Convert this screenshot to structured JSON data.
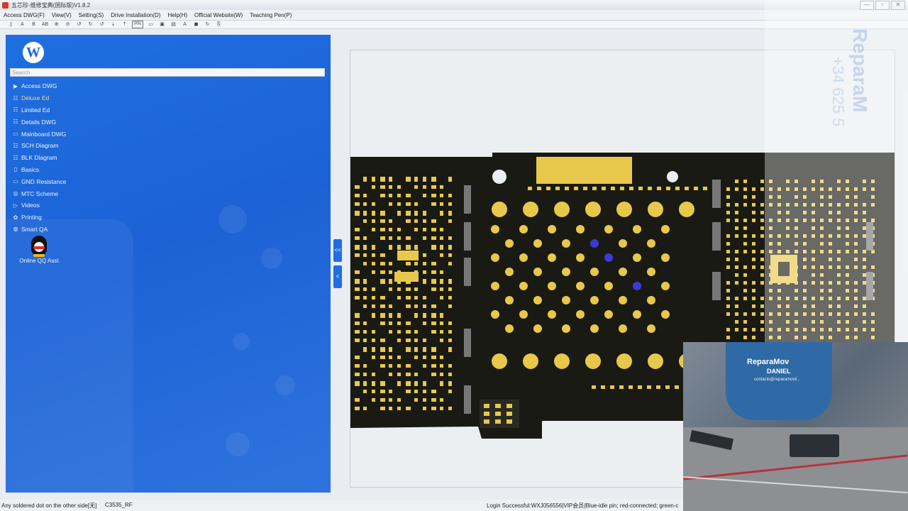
{
  "window": {
    "title": "五芯珍-维修宝典(国际版)V1.8.2",
    "controls": {
      "minimize": "—",
      "maximize": "▫",
      "close": "✕"
    }
  },
  "menu": [
    "Access DWG(F)",
    "View(V)",
    "Setting(S)",
    "Drive Installation(D)",
    "Help(H)",
    "Official Website(W)",
    "Teaching Pen(P)"
  ],
  "toolbar": {
    "tools": [
      "▯",
      "A",
      "B",
      "AB",
      "⊕",
      "⊖",
      "↺",
      "↻",
      "↺",
      "⇣",
      "⇡",
      "PIN",
      "▭",
      "▣",
      "▤",
      "A",
      "◼",
      "↻",
      "⎘"
    ]
  },
  "sidebar": {
    "logo": "W",
    "search_placeholder": "Search",
    "items": [
      {
        "icon": "▶",
        "label": "Access DWG",
        "active": false
      },
      {
        "icon": "☷",
        "label": "Deluxe Ed",
        "active": true
      },
      {
        "icon": "☷",
        "label": "Limited Ed",
        "active": false
      },
      {
        "icon": "☷",
        "label": "Details DWG",
        "active": false
      },
      {
        "icon": "▭",
        "label": "Mainboard DWG",
        "active": false
      },
      {
        "icon": "☷",
        "label": "SCH Diagram",
        "active": false
      },
      {
        "icon": "☷",
        "label": "BLK Diagram",
        "active": false
      },
      {
        "icon": "▯",
        "label": "Basics",
        "active": false
      },
      {
        "icon": "▭",
        "label": "GND Resistance",
        "active": false
      },
      {
        "icon": "◎",
        "label": "MTC Scheme",
        "active": false
      },
      {
        "icon": "▷",
        "label": "Videos",
        "active": false
      },
      {
        "icon": "✿",
        "label": "Printing",
        "active": false
      },
      {
        "icon": "◍",
        "label": "Smart QA",
        "active": false
      }
    ],
    "qq_label": "Online QQ Asst"
  },
  "collapse": {
    "top": "<<",
    "bottom": "<"
  },
  "video": {
    "brand": "ReparaMov",
    "name": "DANIEL",
    "contact": "contacto@reparamovil..."
  },
  "watermark": {
    "brand": "ReparaM",
    "phone": "+34 625 5"
  },
  "status": {
    "left": "Any soldered dot on the other side[无]",
    "mid": "C3535_RF",
    "right": "Login Successful:WXJ056556|VIP会员|Blue-idle pin; red-connected; green-c"
  },
  "colors": {
    "sidebar": "#1f6fe0",
    "pcb_board": "#1a1a14",
    "pcb_pad": "#e8c84a",
    "pcb_pin_highlight": "#3a3ad8",
    "active_nav": "#ffd27a"
  }
}
